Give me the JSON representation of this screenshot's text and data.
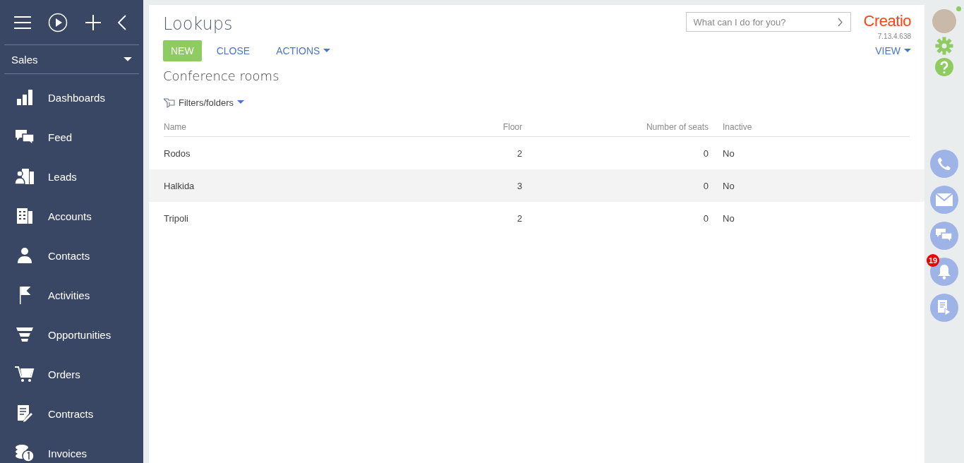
{
  "sidebar": {
    "workplace": "Sales",
    "items": [
      {
        "label": "Dashboards"
      },
      {
        "label": "Feed"
      },
      {
        "label": "Leads"
      },
      {
        "label": "Accounts"
      },
      {
        "label": "Contacts"
      },
      {
        "label": "Activities"
      },
      {
        "label": "Opportunities"
      },
      {
        "label": "Orders"
      },
      {
        "label": "Contracts"
      },
      {
        "label": "Invoices"
      }
    ]
  },
  "header": {
    "title": "Lookups",
    "search": {
      "placeholder": "What can I do for you?"
    },
    "logo": "Creatio",
    "version": "7.13.4.638"
  },
  "toolbar": {
    "buttons": [
      {
        "label": "NEW",
        "kind": "primary"
      },
      {
        "label": "CLOSE",
        "kind": "link"
      },
      {
        "label": "ACTIONS",
        "kind": "menu"
      }
    ],
    "view": "VIEW"
  },
  "section_title": "Conference rooms",
  "filters": "Filters/folders",
  "table": {
    "columns": [
      "Name",
      "Floor",
      "Number of seats",
      "Inactive"
    ],
    "rows": [
      {
        "cells": [
          "Rodos",
          "2",
          "0",
          "No"
        ],
        "selected": false
      },
      {
        "cells": [
          "Halkida",
          "3",
          "0",
          "No"
        ],
        "selected": true
      },
      {
        "cells": [
          "Tripoli",
          "2",
          "0",
          "No"
        ],
        "selected": false
      }
    ]
  },
  "right_bar": {
    "notifications_badge": "19"
  }
}
